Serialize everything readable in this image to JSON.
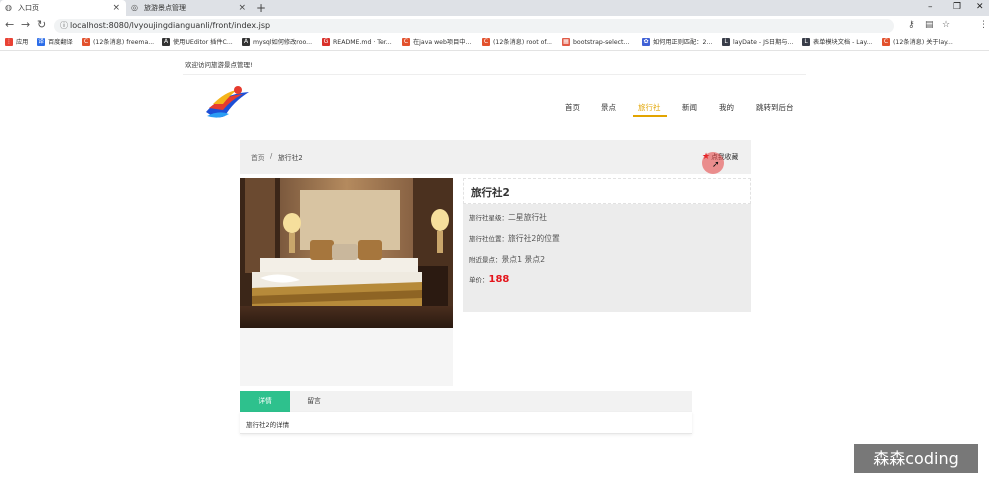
{
  "browser": {
    "tabs": [
      {
        "title": "入口页",
        "icon": "globe-icon",
        "close": "×"
      },
      {
        "title": "旅游景点管理",
        "icon": "globe-icon",
        "close": "×"
      }
    ],
    "new_tab": "+",
    "window_controls": {
      "minimize": "–",
      "restore": "❐",
      "close": "✕"
    },
    "url": "localhost:8080/lvyoujingdianguanli/front/index.jsp",
    "bookmarks": [
      {
        "label": "应用",
        "color": "#e94235",
        "glyph": "⋮"
      },
      {
        "label": "百度翻译",
        "color": "#2b6de9",
        "glyph": "译"
      },
      {
        "label": "(12条消息) freema...",
        "color": "#e2512d",
        "glyph": "C"
      },
      {
        "label": "使用UEditor 插件C...",
        "color": "#333333",
        "glyph": "A"
      },
      {
        "label": "mysql如何修改roo...",
        "color": "#333333",
        "glyph": "A"
      },
      {
        "label": "README.md · Ter...",
        "color": "#d9302a",
        "glyph": "G"
      },
      {
        "label": "在java web项目中...",
        "color": "#e2512d",
        "glyph": "C"
      },
      {
        "label": "(12条消息) root of...",
        "color": "#e2512d",
        "glyph": "C"
      },
      {
        "label": "bootstrap-select...",
        "color": "#e05a46",
        "glyph": "▦"
      },
      {
        "label": "如何用正则匹配：2...",
        "color": "#4061d6",
        "glyph": "✿"
      },
      {
        "label": "layDate - JS日期与...",
        "color": "#393d49",
        "glyph": "L"
      },
      {
        "label": "表单模块文档 - Lay...",
        "color": "#393d49",
        "glyph": "L"
      },
      {
        "label": "(12条消息) 关于lay...",
        "color": "#e2512d",
        "glyph": "C"
      }
    ]
  },
  "header": {
    "welcome": "欢迎访问旅游景点管理!",
    "nav": [
      {
        "label": "首页",
        "active": false
      },
      {
        "label": "景点",
        "active": false
      },
      {
        "label": "旅行社",
        "active": true
      },
      {
        "label": "新闻",
        "active": false
      },
      {
        "label": "我的",
        "active": false
      },
      {
        "label": "跳转到后台",
        "active": false
      }
    ]
  },
  "breadcrumb": {
    "home": "首页",
    "separator": "/",
    "current": "旅行社2",
    "favorite": "点我收藏"
  },
  "agency": {
    "title": "旅行社2",
    "level_label": "旅行社星级：",
    "level_value": "二星旅行社",
    "location_label": "旅行社位置：",
    "location_value": "旅行社2的位置",
    "nearby_label": "附近景点：",
    "nearby_value": "景点1 景点2",
    "price_label": "单价：",
    "price_value": "188"
  },
  "detail_tabs": {
    "tabs": [
      "详情",
      "留言"
    ],
    "active_index": 0,
    "content": "旅行社2的详情"
  },
  "watermark": "森森coding",
  "colors": {
    "accent": "#e2a400",
    "tab_active": "#2ec18d",
    "price": "#e4141b"
  }
}
